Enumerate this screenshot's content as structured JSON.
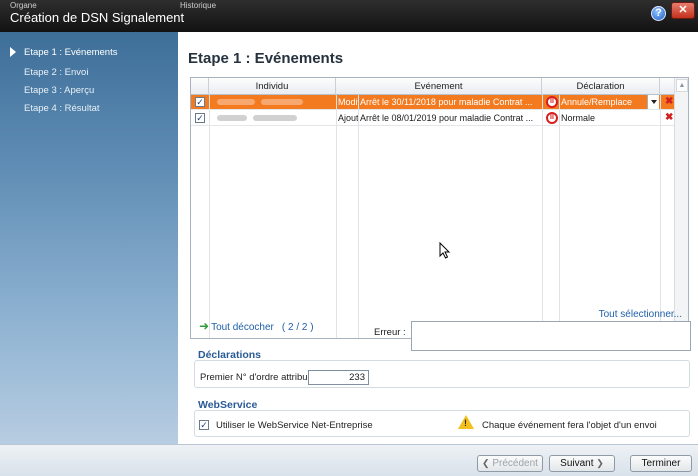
{
  "window": {
    "title": "Création de DSN Signalement",
    "behind_left": "Organe",
    "behind_center": "Historique"
  },
  "sidebar": {
    "items": [
      {
        "label": "Etape 1 : Evénements"
      },
      {
        "label": "Etape 2 : Envoi"
      },
      {
        "label": "Etape 3 : Aperçu"
      },
      {
        "label": "Etape 4 : Résultat"
      }
    ]
  },
  "main": {
    "heading": "Etape 1 : Evénements",
    "grid": {
      "columns": [
        "Individu",
        "Evénement",
        "Déclaration"
      ],
      "rows": [
        {
          "checked": "✓",
          "type": "Modif",
          "event": "Arrêt le 30/11/2018 pour maladie Contrat ...",
          "decl": "Annule/Remplace",
          "selected": true
        },
        {
          "checked": "✓",
          "type": "Ajout",
          "event": "Arrêt le 08/01/2019 pour maladie Contrat ...",
          "decl": "Normale",
          "selected": false
        }
      ]
    },
    "uncheck_label": "Tout décocher",
    "uncheck_count": "( 2 / 2 )",
    "select_all_label": "Tout sélectionner...",
    "error_label": "Erreur :",
    "declarations": {
      "title": "Déclarations",
      "order_label": "Premier N° d'ordre attribué :",
      "order_value": "233"
    },
    "webservice": {
      "title": "WebService",
      "use_label": "Utiliser le WebService Net-Entreprise",
      "checked": "✓",
      "warning_text": "Chaque événement fera l'objet d'un envoi"
    }
  },
  "footer": {
    "prev_label": "Précédent",
    "next_label": "Suivant",
    "finish_label": "Terminer"
  },
  "colors": {
    "selection": "#f47a1f",
    "section_title": "#2a5a96"
  }
}
